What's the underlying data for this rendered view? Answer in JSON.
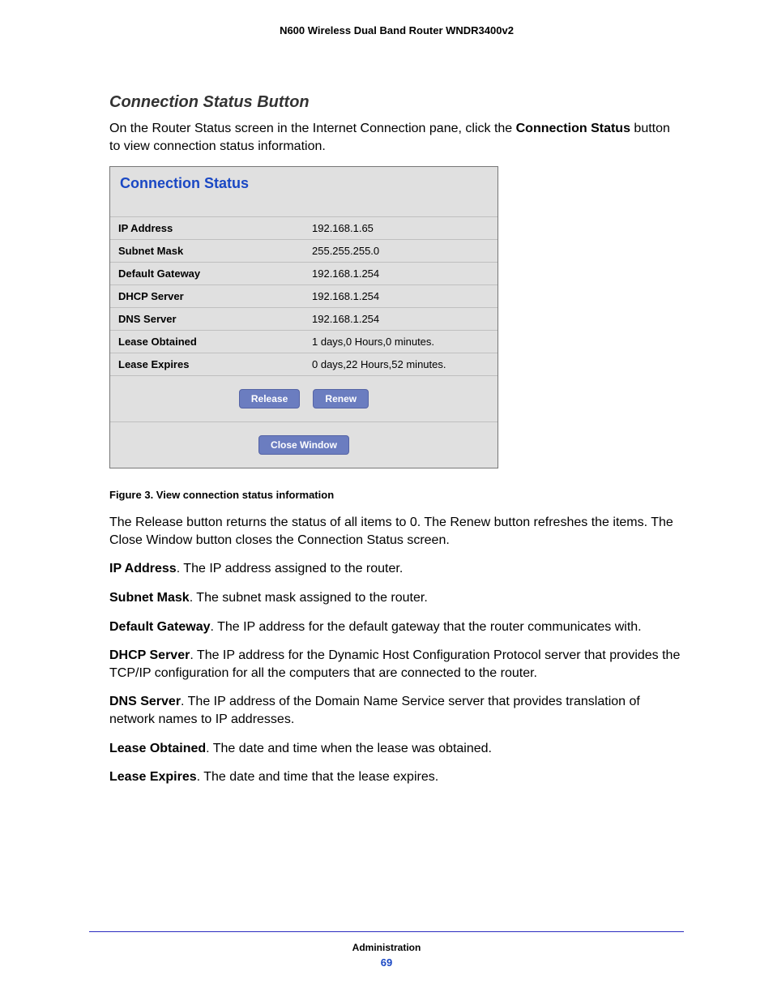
{
  "doc_header": "N600 Wireless Dual Band Router WNDR3400v2",
  "section_heading": "Connection Status Button",
  "intro_text_pre": "On the Router Status screen in the Internet Connection pane, click the ",
  "intro_bold": "Connection Status",
  "intro_text_post": " button to view connection status information.",
  "panel": {
    "title": "Connection Status",
    "rows": [
      {
        "label": "IP Address",
        "value": "192.168.1.65"
      },
      {
        "label": "Subnet Mask",
        "value": "255.255.255.0"
      },
      {
        "label": "Default Gateway",
        "value": "192.168.1.254"
      },
      {
        "label": "DHCP Server",
        "value": "192.168.1.254"
      },
      {
        "label": "DNS Server",
        "value": "192.168.1.254"
      },
      {
        "label": "Lease Obtained",
        "value": "1 days,0 Hours,0 minutes."
      },
      {
        "label": "Lease Expires",
        "value": "0 days,22 Hours,52 minutes."
      }
    ],
    "buttons_upper": {
      "release": "Release",
      "renew": "Renew"
    },
    "buttons_lower": {
      "close": "Close Window"
    }
  },
  "figure_caption": "Figure 3. View connection status information",
  "para_after": "The Release button returns the status of all items to 0. The Renew button refreshes the items. The Close Window button closes the Connection Status screen.",
  "definitions": [
    {
      "term": "IP Address",
      "desc": ". The IP address assigned to the router."
    },
    {
      "term": "Subnet Mask",
      "desc": ". The subnet mask assigned to the router."
    },
    {
      "term": "Default Gateway",
      "desc": ". The IP address for the default gateway that the router communicates with."
    },
    {
      "term": "DHCP Server",
      "desc": ". The IP address for the Dynamic Host Configuration Protocol server that provides the TCP/IP configuration for all the computers that are connected to the router."
    },
    {
      "term": "DNS Server",
      "desc": ". The IP address of the Domain Name Service server that provides translation of network names to IP addresses."
    },
    {
      "term": "Lease Obtained",
      "desc": ". The date and time when the lease was obtained."
    },
    {
      "term": "Lease Expires",
      "desc": ". The date and time that the lease expires."
    }
  ],
  "footer": {
    "section": "Administration",
    "page": "69"
  }
}
